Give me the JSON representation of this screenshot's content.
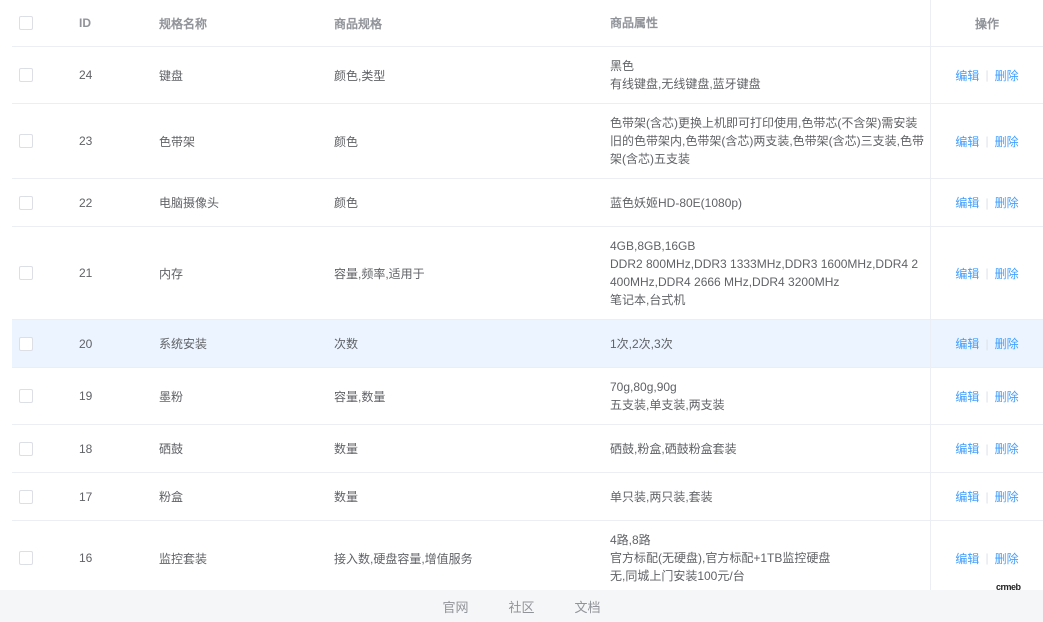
{
  "table": {
    "headers": {
      "id": "ID",
      "name": "规格名称",
      "spec": "商品规格",
      "attr": "商品属性",
      "op": "操作"
    },
    "rows": [
      {
        "id": "24",
        "name": "键盘",
        "spec": "颜色,类型",
        "attr": "黑色\n有线键盘,无线键盘,蓝牙键盘"
      },
      {
        "id": "23",
        "name": "色带架",
        "spec": "颜色",
        "attr": "色带架(含芯)更换上机即可打印使用,色带芯(不含架)需安装\n旧的色带架内,色带架(含芯)两支装,色带架(含芯)三支装,色带\n架(含芯)五支装"
      },
      {
        "id": "22",
        "name": "电脑摄像头",
        "spec": "颜色",
        "attr": "蓝色妖姬HD-80E(1080p)"
      },
      {
        "id": "21",
        "name": "内存",
        "spec": "容量,频率,适用于",
        "attr": "4GB,8GB,16GB\nDDR2 800MHz,DDR3 1333MHz,DDR3 1600MHz,DDR4 2\n400MHz,DDR4 2666 MHz,DDR4 3200MHz\n笔记本,台式机"
      },
      {
        "id": "20",
        "name": "系统安装",
        "spec": "次数",
        "attr": "1次,2次,3次"
      },
      {
        "id": "19",
        "name": "墨粉",
        "spec": "容量,数量",
        "attr": "70g,80g,90g\n五支装,单支装,两支装"
      },
      {
        "id": "18",
        "name": "硒鼓",
        "spec": "数量",
        "attr": "硒鼓,粉盒,硒鼓粉盒套装"
      },
      {
        "id": "17",
        "name": "粉盒",
        "spec": "数量",
        "attr": "单只装,两只装,套装"
      },
      {
        "id": "16",
        "name": "监控套装",
        "spec": "接入数,硬盘容量,增值服务",
        "attr": "4路,8路\n官方标配(无硬盘),官方标配+1TB监控硬盘\n无,同城上门安装100元/台"
      }
    ],
    "highlighted_row_id": "20",
    "edit_label": "编辑",
    "delete_label": "删除"
  },
  "footer": {
    "links": [
      "官网",
      "社区",
      "文档"
    ]
  },
  "brand": "crmeb",
  "colors": {
    "link": "#409eff",
    "row_highlight": "#ecf5ff",
    "border": "#ebeef5"
  }
}
